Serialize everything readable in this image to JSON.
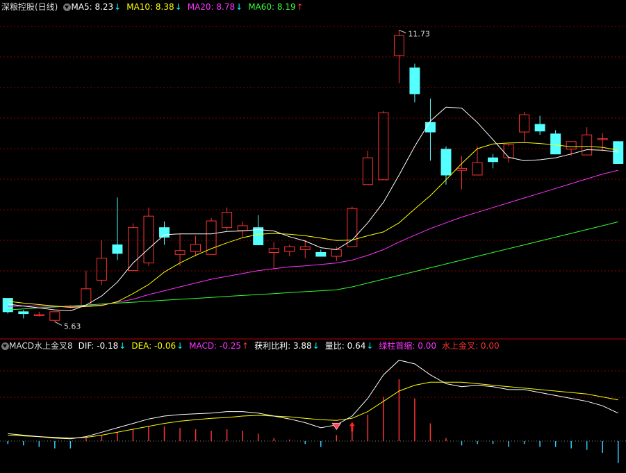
{
  "price_panel": {
    "title": "深粮控股(日线)",
    "indicators": [
      {
        "label": "MA5:",
        "value": "8.23",
        "dir": "↓",
        "color": "#ffffff",
        "dircolor": "#00ffff"
      },
      {
        "label": "MA10:",
        "value": "8.38",
        "dir": "↓",
        "color": "#ffff00",
        "dircolor": "#00ffff"
      },
      {
        "label": "MA20:",
        "value": "8.78",
        "dir": "↓",
        "color": "#ff33ff",
        "dircolor": "#00ffff"
      },
      {
        "label": "MA60:",
        "value": "8.19",
        "dir": "↑",
        "color": "#33ff33",
        "dircolor": "#ff3333"
      }
    ],
    "high_label": "11.73",
    "low_label": "5.63"
  },
  "macd_panel": {
    "title": "MACD水上金叉8",
    "indicators": [
      {
        "label": "DIF:",
        "value": "-0.18",
        "dir": "↓",
        "color": "#ffffff",
        "dircolor": "#00ffff"
      },
      {
        "label": "DEA:",
        "value": "-0.06",
        "dir": "↓",
        "color": "#ffff00",
        "dircolor": "#00ffff"
      },
      {
        "label": "MACD:",
        "value": "-0.25",
        "dir": "↑",
        "color": "#ff33ff",
        "dircolor": "#ff3333"
      },
      {
        "label": "获利比利:",
        "value": "3.88",
        "dir": "↓",
        "color": "#ffffff",
        "dircolor": "#00ffff"
      },
      {
        "label": "量比:",
        "value": "0.64",
        "dir": "↓",
        "color": "#ffffff",
        "dircolor": "#00ffff"
      },
      {
        "label": "绿柱首缩:",
        "value": "0.00",
        "dir": "",
        "color": "#ff33ff",
        "dircolor": ""
      },
      {
        "label": "水上金叉:",
        "value": "0.00",
        "dir": "",
        "color": "#ff3333",
        "dircolor": ""
      }
    ]
  },
  "colors": {
    "up": "#ff3333",
    "down": "#54ffff",
    "ma5": "#ffffff",
    "ma10": "#ffff00",
    "ma20": "#ff33ff",
    "ma60": "#33ff33",
    "grid": "#8b0000",
    "macd_down": "#33ccff"
  },
  "chart_data": {
    "type": "candlestick",
    "series_candles": [
      {
        "o": 6.12,
        "h": 6.12,
        "l": 5.8,
        "c": 5.84
      },
      {
        "o": 5.84,
        "h": 5.88,
        "l": 5.7,
        "c": 5.8
      },
      {
        "o": 5.78,
        "h": 5.84,
        "l": 5.74,
        "c": 5.78
      },
      {
        "o": 5.66,
        "h": 5.84,
        "l": 5.63,
        "c": 5.84
      },
      {
        "o": 5.96,
        "h": 5.98,
        "l": 5.92,
        "c": 5.96
      },
      {
        "o": 5.96,
        "h": 6.7,
        "l": 5.96,
        "c": 6.32
      },
      {
        "o": 6.5,
        "h": 7.34,
        "l": 6.4,
        "c": 6.96
      },
      {
        "o": 7.24,
        "h": 8.23,
        "l": 6.92,
        "c": 7.06
      },
      {
        "o": 6.7,
        "h": 7.69,
        "l": 6.7,
        "c": 7.6
      },
      {
        "o": 6.86,
        "h": 8.02,
        "l": 6.8,
        "c": 7.84
      },
      {
        "o": 7.6,
        "h": 7.73,
        "l": 7.24,
        "c": 7.4
      },
      {
        "o": 7.04,
        "h": 7.48,
        "l": 6.8,
        "c": 7.12
      },
      {
        "o": 7.1,
        "h": 7.43,
        "l": 7.0,
        "c": 7.25
      },
      {
        "o": 7.04,
        "h": 7.8,
        "l": 7.04,
        "c": 7.74
      },
      {
        "o": 7.6,
        "h": 8.02,
        "l": 7.54,
        "c": 7.92
      },
      {
        "o": 7.54,
        "h": 7.73,
        "l": 7.4,
        "c": 7.64
      },
      {
        "o": 7.6,
        "h": 7.86,
        "l": 7.36,
        "c": 7.24
      },
      {
        "o": 7.08,
        "h": 7.3,
        "l": 6.74,
        "c": 7.16
      },
      {
        "o": 7.1,
        "h": 7.24,
        "l": 7.0,
        "c": 7.2
      },
      {
        "o": 7.14,
        "h": 7.34,
        "l": 6.96,
        "c": 7.2
      },
      {
        "o": 7.08,
        "h": 7.14,
        "l": 7.0,
        "c": 7.0
      },
      {
        "o": 7.0,
        "h": 7.2,
        "l": 6.9,
        "c": 7.14
      },
      {
        "o": 7.2,
        "h": 8.04,
        "l": 7.2,
        "c": 8.0
      },
      {
        "o": 8.5,
        "h": 9.21,
        "l": 8.5,
        "c": 9.06
      },
      {
        "o": 8.6,
        "h": 10.04,
        "l": 8.6,
        "c": 10.0
      },
      {
        "o": 11.2,
        "h": 11.73,
        "l": 10.62,
        "c": 11.62
      },
      {
        "o": 10.94,
        "h": 11.03,
        "l": 10.22,
        "c": 10.4
      },
      {
        "o": 9.8,
        "h": 10.3,
        "l": 9.0,
        "c": 9.6
      },
      {
        "o": 9.24,
        "h": 9.3,
        "l": 8.5,
        "c": 8.7
      },
      {
        "o": 8.8,
        "h": 9.1,
        "l": 8.4,
        "c": 8.84
      },
      {
        "o": 8.7,
        "h": 9.3,
        "l": 8.7,
        "c": 8.96
      },
      {
        "o": 9.06,
        "h": 9.14,
        "l": 8.84,
        "c": 8.98
      },
      {
        "o": 9.06,
        "h": 9.3,
        "l": 8.96,
        "c": 9.34
      },
      {
        "o": 9.6,
        "h": 10.02,
        "l": 9.4,
        "c": 9.96
      },
      {
        "o": 9.76,
        "h": 9.94,
        "l": 9.54,
        "c": 9.62
      },
      {
        "o": 9.56,
        "h": 9.64,
        "l": 9.14,
        "c": 9.14
      },
      {
        "o": 9.24,
        "h": 9.4,
        "l": 9.1,
        "c": 9.4
      },
      {
        "o": 9.12,
        "h": 9.7,
        "l": 9.12,
        "c": 9.54
      },
      {
        "o": 9.46,
        "h": 9.58,
        "l": 9.2,
        "c": 9.46
      },
      {
        "o": 9.4,
        "h": 9.4,
        "l": 8.94,
        "c": 8.94
      }
    ],
    "ma5": [
      6.0,
      5.96,
      5.92,
      5.88,
      5.86,
      5.98,
      6.17,
      6.46,
      6.86,
      7.16,
      7.45,
      7.47,
      7.47,
      7.47,
      7.52,
      7.53,
      7.56,
      7.53,
      7.41,
      7.32,
      7.18,
      7.14,
      7.34,
      7.7,
      8.13,
      8.7,
      9.3,
      9.83,
      10.12,
      10.1,
      9.8,
      9.44,
      9.07,
      9.0,
      9.02,
      9.06,
      9.14,
      9.23,
      9.22,
      9.18
    ],
    "ma10": [
      6.06,
      6.02,
      5.99,
      5.96,
      5.93,
      5.95,
      5.97,
      6.05,
      6.22,
      6.41,
      6.67,
      6.86,
      7.02,
      7.16,
      7.28,
      7.39,
      7.46,
      7.48,
      7.46,
      7.43,
      7.38,
      7.33,
      7.34,
      7.43,
      7.51,
      7.7,
      7.99,
      8.27,
      8.6,
      8.94,
      9.25,
      9.35,
      9.37,
      9.38,
      9.36,
      9.33,
      9.29,
      9.3,
      9.28,
      9.22
    ],
    "ma20": [
      5.95,
      5.96,
      5.96,
      5.95,
      5.95,
      5.96,
      5.98,
      6.04,
      6.1,
      6.2,
      6.28,
      6.36,
      6.44,
      6.52,
      6.58,
      6.64,
      6.7,
      6.74,
      6.78,
      6.8,
      6.83,
      6.86,
      6.92,
      7.02,
      7.14,
      7.3,
      7.44,
      7.58,
      7.7,
      7.82,
      7.92,
      8.02,
      8.12,
      8.22,
      8.32,
      8.42,
      8.52,
      8.62,
      8.72,
      8.8
    ],
    "ma60": [
      5.88,
      5.9,
      5.92,
      5.94,
      5.96,
      5.98,
      6.0,
      6.02,
      6.04,
      6.06,
      6.08,
      6.1,
      6.12,
      6.14,
      6.16,
      6.18,
      6.2,
      6.22,
      6.24,
      6.26,
      6.28,
      6.3,
      6.36,
      6.44,
      6.52,
      6.6,
      6.68,
      6.76,
      6.84,
      6.92,
      7.0,
      7.08,
      7.16,
      7.24,
      7.32,
      7.4,
      7.48,
      7.56,
      7.64,
      7.72
    ],
    "price_ylim": [
      5.3,
      12.1
    ],
    "macd_dif": [
      0.1,
      0.08,
      0.06,
      0.04,
      0.03,
      0.06,
      0.12,
      0.18,
      0.24,
      0.3,
      0.34,
      0.36,
      0.37,
      0.38,
      0.4,
      0.4,
      0.38,
      0.34,
      0.3,
      0.25,
      0.18,
      0.22,
      0.34,
      0.58,
      0.9,
      1.1,
      1.05,
      0.9,
      0.78,
      0.74,
      0.76,
      0.74,
      0.7,
      0.7,
      0.66,
      0.62,
      0.58,
      0.54,
      0.48,
      0.38
    ],
    "macd_dea": [
      0.08,
      0.07,
      0.06,
      0.05,
      0.04,
      0.05,
      0.08,
      0.12,
      0.16,
      0.2,
      0.24,
      0.27,
      0.29,
      0.31,
      0.32,
      0.34,
      0.35,
      0.34,
      0.33,
      0.31,
      0.29,
      0.28,
      0.31,
      0.4,
      0.54,
      0.68,
      0.76,
      0.8,
      0.8,
      0.8,
      0.78,
      0.76,
      0.74,
      0.72,
      0.7,
      0.68,
      0.66,
      0.64,
      0.6,
      0.56
    ],
    "macd_hist": [
      -0.04,
      -0.06,
      -0.08,
      -0.1,
      -0.1,
      0.04,
      0.08,
      0.12,
      0.16,
      0.2,
      0.2,
      0.18,
      0.16,
      0.14,
      0.16,
      0.14,
      0.1,
      0.04,
      0.02,
      -0.04,
      -0.08,
      0.08,
      0.2,
      0.36,
      0.6,
      0.84,
      0.58,
      0.24,
      0.04,
      -0.06,
      -0.04,
      -0.04,
      -0.08,
      -0.04,
      -0.08,
      -0.08,
      -0.1,
      -0.12,
      -0.16,
      -0.3
    ],
    "macd_ylim": [
      -0.35,
      1.2
    ]
  }
}
